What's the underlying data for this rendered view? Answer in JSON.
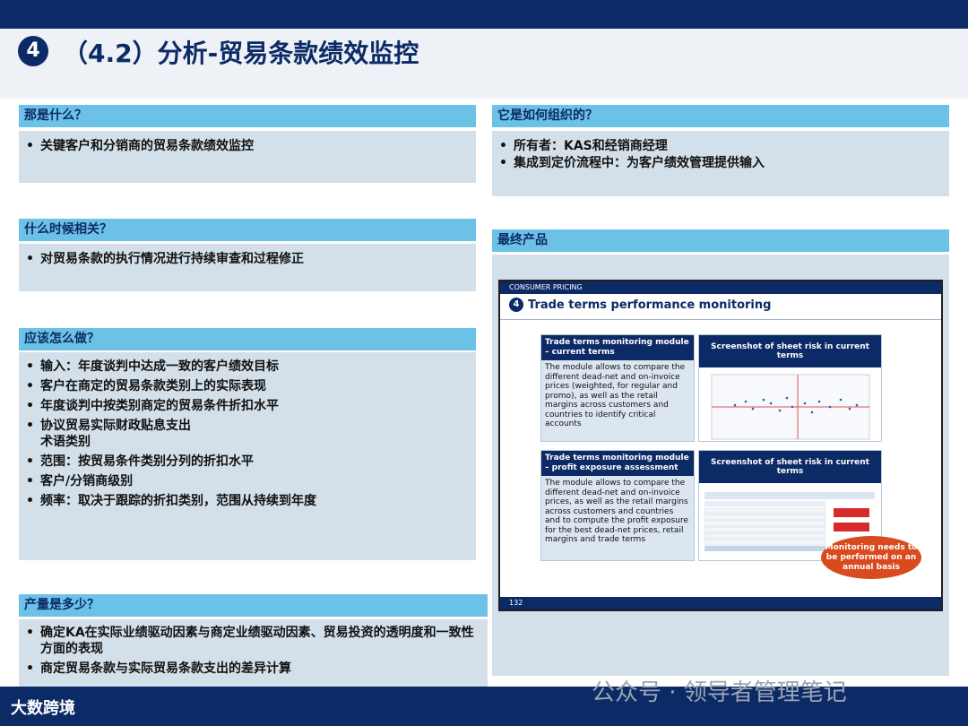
{
  "title": {
    "number": "4",
    "text": "（4.2）分析-贸易条款绩效监控"
  },
  "left": {
    "what": {
      "heading": "那是什么？",
      "items": [
        "关键客户和分销商的贸易条款绩效监控"
      ]
    },
    "when": {
      "heading": "什么时候相关？",
      "items": [
        "对贸易条款的执行情况进行持续审查和过程修正"
      ]
    },
    "how": {
      "heading": "应该怎么做？",
      "items": [
        "输入：年度谈判中达成一致的客户绩效目标",
        "客户在商定的贸易条款类别上的实际表现",
        "年度谈判中按类别商定的贸易条件折扣水平",
        "协议贸易实际财政贴息支出",
        "术语类别",
        "范围：按贸易条件类别分列的折扣水平",
        "客户/分销商级别",
        "频率：取决于跟踪的折扣类别，范围从持续到年度"
      ]
    },
    "output": {
      "heading": "产量是多少？",
      "items": [
        "确定KA在实际业绩驱动因素与商定业绩驱动因素、贸易投资的透明度和一致性方面的表现",
        "商定贸易条款与实际贸易条款支出的差异计算"
      ]
    }
  },
  "right": {
    "org": {
      "heading": "它是如何组织的？",
      "items": [
        "所有者：KAS和经销商经理",
        "集成到定价流程中：为客户绩效管理提供输入"
      ]
    },
    "product": {
      "heading": "最终产品",
      "preview": {
        "top_label": "CONSUMER PRICING",
        "number": "4",
        "title": "Trade terms performance monitoring",
        "module1": {
          "head": "Trade terms monitoring module – current terms",
          "text": "The module allows to compare the different dead-net and on-invoice prices (weighted, for regular and promo), as well as the retail margins across customers and countries to identify critical accounts"
        },
        "shot1_head": "Screenshot of sheet risk in current terms",
        "module2": {
          "head": "Trade terms monitoring module – profit exposure assessment",
          "text": "The module allows to compare the different dead-net and on-invoice prices, as well as the retail margins across customers and countries and to compute the profit exposure for the best dead-net prices, retail margins and trade terms"
        },
        "shot2_head": "Screenshot of sheet risk in current terms",
        "badge": "Monitoring needs to be performed on an annual basis",
        "page_number": "132"
      }
    }
  },
  "footer": {
    "logo": "大数跨境",
    "watermark": "公众号 · 领导者管理笔记"
  }
}
